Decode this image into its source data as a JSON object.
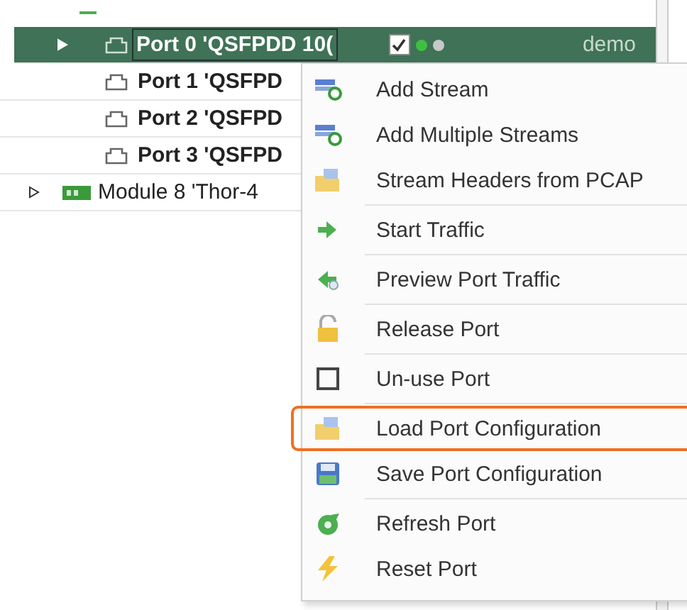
{
  "tree": {
    "rows": [
      {
        "kind": "port",
        "label": "Port 0 'QSFPDD 10(",
        "selected": true,
        "expander": true,
        "checked": true,
        "dots": [
          {
            "color": "#3fbf3f"
          },
          {
            "color": "#c8c8c8"
          }
        ],
        "owner": "demo"
      },
      {
        "kind": "port",
        "label": "Port 1 'QSFPD",
        "selected": false,
        "expander": false
      },
      {
        "kind": "port",
        "label": "Port 2 'QSFPD",
        "selected": false,
        "expander": false
      },
      {
        "kind": "port",
        "label": "Port 3 'QSFPD",
        "selected": false,
        "expander": false
      },
      {
        "kind": "module",
        "label": "Module 8 'Thor-4",
        "selected": false,
        "expander": true
      }
    ]
  },
  "context_menu": {
    "items": [
      {
        "label": "Add Stream",
        "highlighted": false,
        "separator": false
      },
      {
        "label": "Add Multiple Streams",
        "highlighted": false,
        "separator": false
      },
      {
        "label": "Stream Headers from PCAP",
        "highlighted": false,
        "separator": true
      },
      {
        "label": "Start Traffic",
        "highlighted": false,
        "separator": true
      },
      {
        "label": "Preview Port Traffic",
        "highlighted": false,
        "separator": true
      },
      {
        "label": "Release Port",
        "highlighted": false,
        "separator": true
      },
      {
        "label": "Un-use Port",
        "highlighted": false,
        "separator": true
      },
      {
        "label": "Load Port Configuration",
        "highlighted": true,
        "separator": false
      },
      {
        "label": "Save Port Configuration",
        "highlighted": false,
        "separator": true
      },
      {
        "label": "Refresh Port",
        "highlighted": false,
        "separator": false
      },
      {
        "label": "Reset Port",
        "highlighted": false,
        "separator": false
      }
    ]
  }
}
